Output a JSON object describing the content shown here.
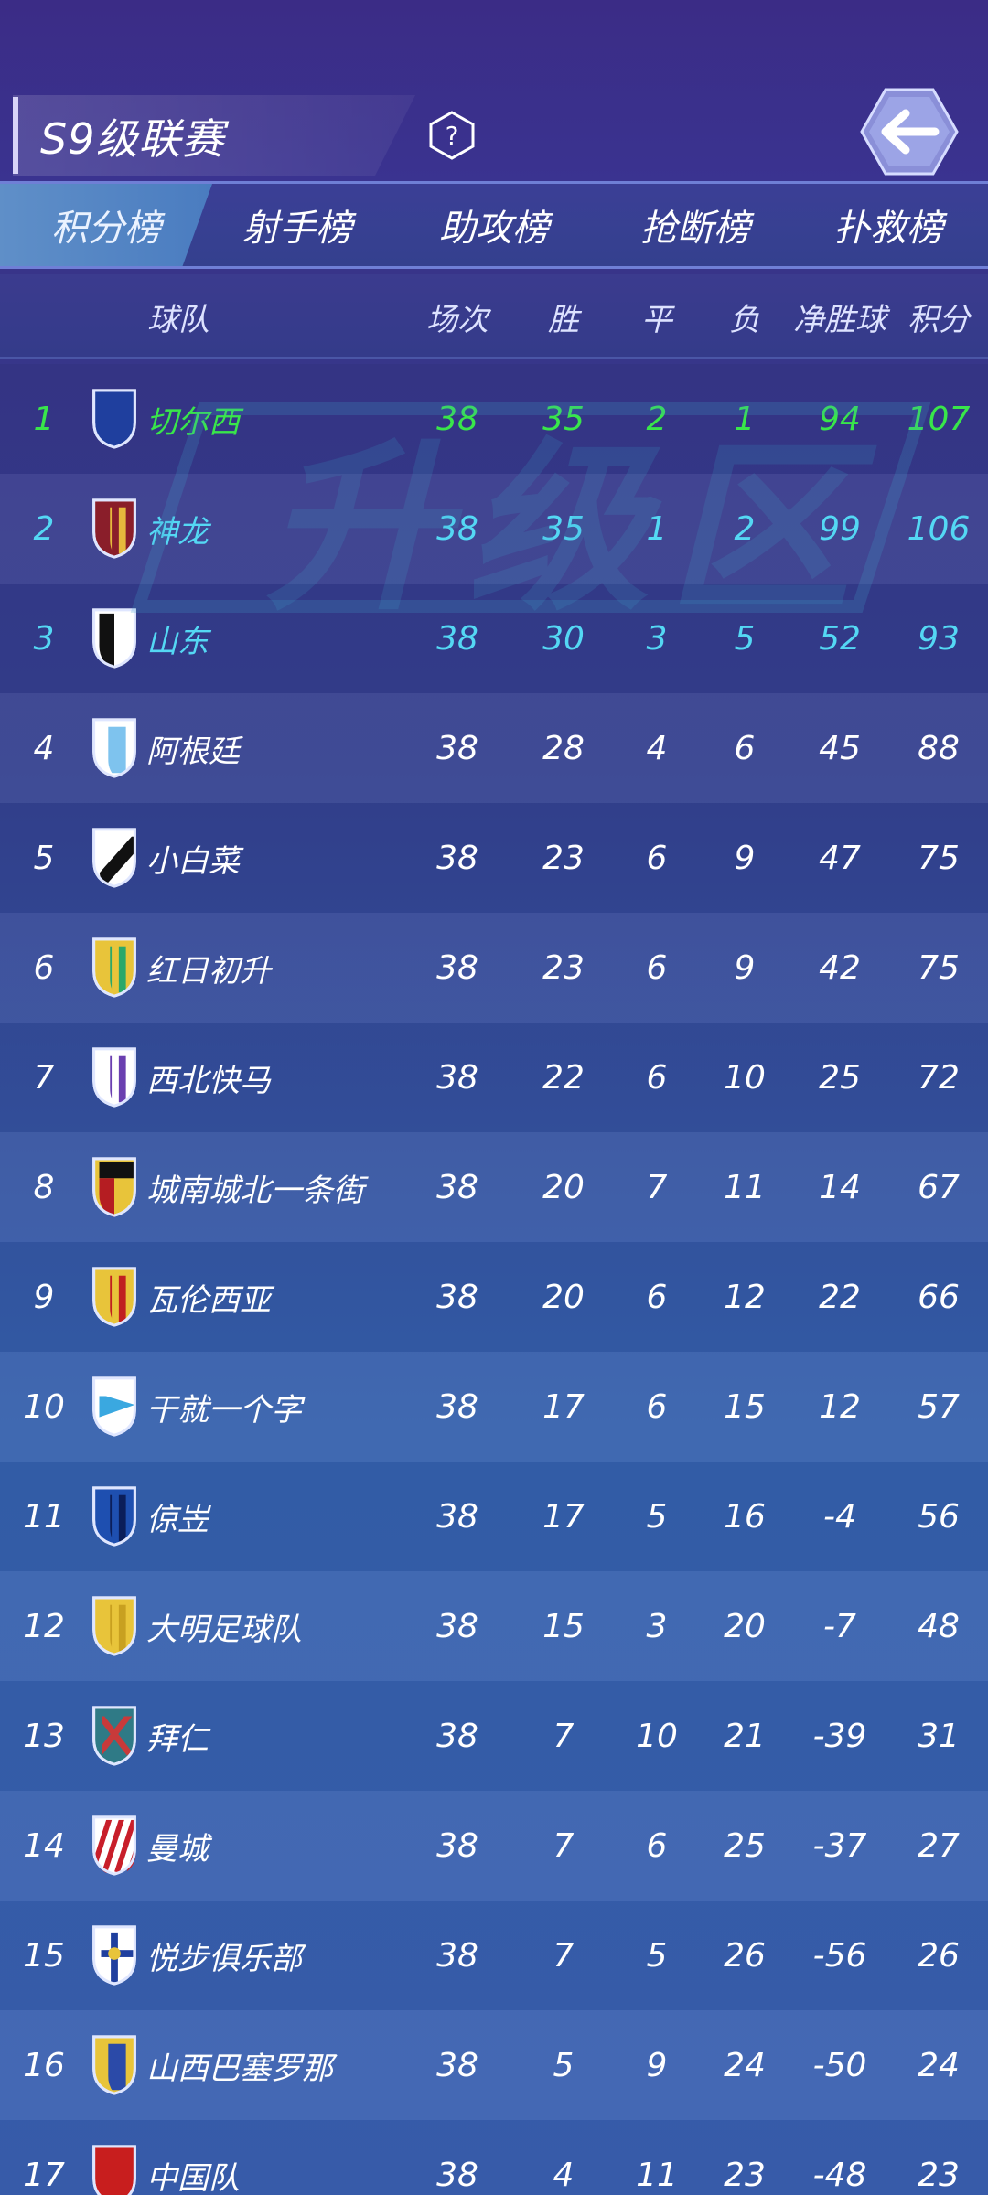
{
  "header": {
    "league_title": "S9级联赛",
    "help_icon": "question-icon",
    "back_icon": "back-arrow-icon"
  },
  "tabs": [
    {
      "label": "积分榜",
      "active": true
    },
    {
      "label": "射手榜",
      "active": false
    },
    {
      "label": "助攻榜",
      "active": false
    },
    {
      "label": "抢断榜",
      "active": false
    },
    {
      "label": "扑救榜",
      "active": false
    }
  ],
  "table": {
    "columns": {
      "team": "球队",
      "played": "场次",
      "won": "胜",
      "drawn": "平",
      "lost": "负",
      "goal_diff": "净胜球",
      "points": "积分"
    },
    "promotion_label": "升级区",
    "rows": [
      {
        "rank": "1",
        "team": "切尔西",
        "played": "38",
        "won": "35",
        "drawn": "2",
        "lost": "1",
        "gd": "94",
        "pts": "107"
      },
      {
        "rank": "2",
        "team": "神龙",
        "played": "38",
        "won": "35",
        "drawn": "1",
        "lost": "2",
        "gd": "99",
        "pts": "106"
      },
      {
        "rank": "3",
        "team": "山东",
        "played": "38",
        "won": "30",
        "drawn": "3",
        "lost": "5",
        "gd": "52",
        "pts": "93"
      },
      {
        "rank": "4",
        "team": "阿根廷",
        "played": "38",
        "won": "28",
        "drawn": "4",
        "lost": "6",
        "gd": "45",
        "pts": "88"
      },
      {
        "rank": "5",
        "team": "小白菜",
        "played": "38",
        "won": "23",
        "drawn": "6",
        "lost": "9",
        "gd": "47",
        "pts": "75"
      },
      {
        "rank": "6",
        "team": "红日初升",
        "played": "38",
        "won": "23",
        "drawn": "6",
        "lost": "9",
        "gd": "42",
        "pts": "75"
      },
      {
        "rank": "7",
        "team": "西北快马",
        "played": "38",
        "won": "22",
        "drawn": "6",
        "lost": "10",
        "gd": "25",
        "pts": "72"
      },
      {
        "rank": "8",
        "team": "城南城北一条街",
        "played": "38",
        "won": "20",
        "drawn": "7",
        "lost": "11",
        "gd": "14",
        "pts": "67"
      },
      {
        "rank": "9",
        "team": "瓦伦西亚",
        "played": "38",
        "won": "20",
        "drawn": "6",
        "lost": "12",
        "gd": "22",
        "pts": "66"
      },
      {
        "rank": "10",
        "team": "干就一个字",
        "played": "38",
        "won": "17",
        "drawn": "6",
        "lost": "15",
        "gd": "12",
        "pts": "57"
      },
      {
        "rank": "11",
        "team": "倞岦",
        "played": "38",
        "won": "17",
        "drawn": "5",
        "lost": "16",
        "gd": "-4",
        "pts": "56"
      },
      {
        "rank": "12",
        "team": "大明足球队",
        "played": "38",
        "won": "15",
        "drawn": "3",
        "lost": "20",
        "gd": "-7",
        "pts": "48"
      },
      {
        "rank": "13",
        "team": "拜仁",
        "played": "38",
        "won": "7",
        "drawn": "10",
        "lost": "21",
        "gd": "-39",
        "pts": "31"
      },
      {
        "rank": "14",
        "team": "曼城",
        "played": "38",
        "won": "7",
        "drawn": "6",
        "lost": "25",
        "gd": "-37",
        "pts": "27"
      },
      {
        "rank": "15",
        "team": "悦步俱乐部",
        "played": "38",
        "won": "7",
        "drawn": "5",
        "lost": "26",
        "gd": "-56",
        "pts": "26"
      },
      {
        "rank": "16",
        "team": "山西巴塞罗那",
        "played": "38",
        "won": "5",
        "drawn": "9",
        "lost": "24",
        "gd": "-50",
        "pts": "24"
      },
      {
        "rank": "17",
        "team": "中国队",
        "played": "38",
        "won": "4",
        "drawn": "11",
        "lost": "23",
        "gd": "-48",
        "pts": "23"
      }
    ]
  },
  "colors": {
    "rank1_text": "#39e64a",
    "rank2_3_text": "#54d8f4",
    "default_text": "#ffffff",
    "watermark": "#3ea0c8"
  }
}
